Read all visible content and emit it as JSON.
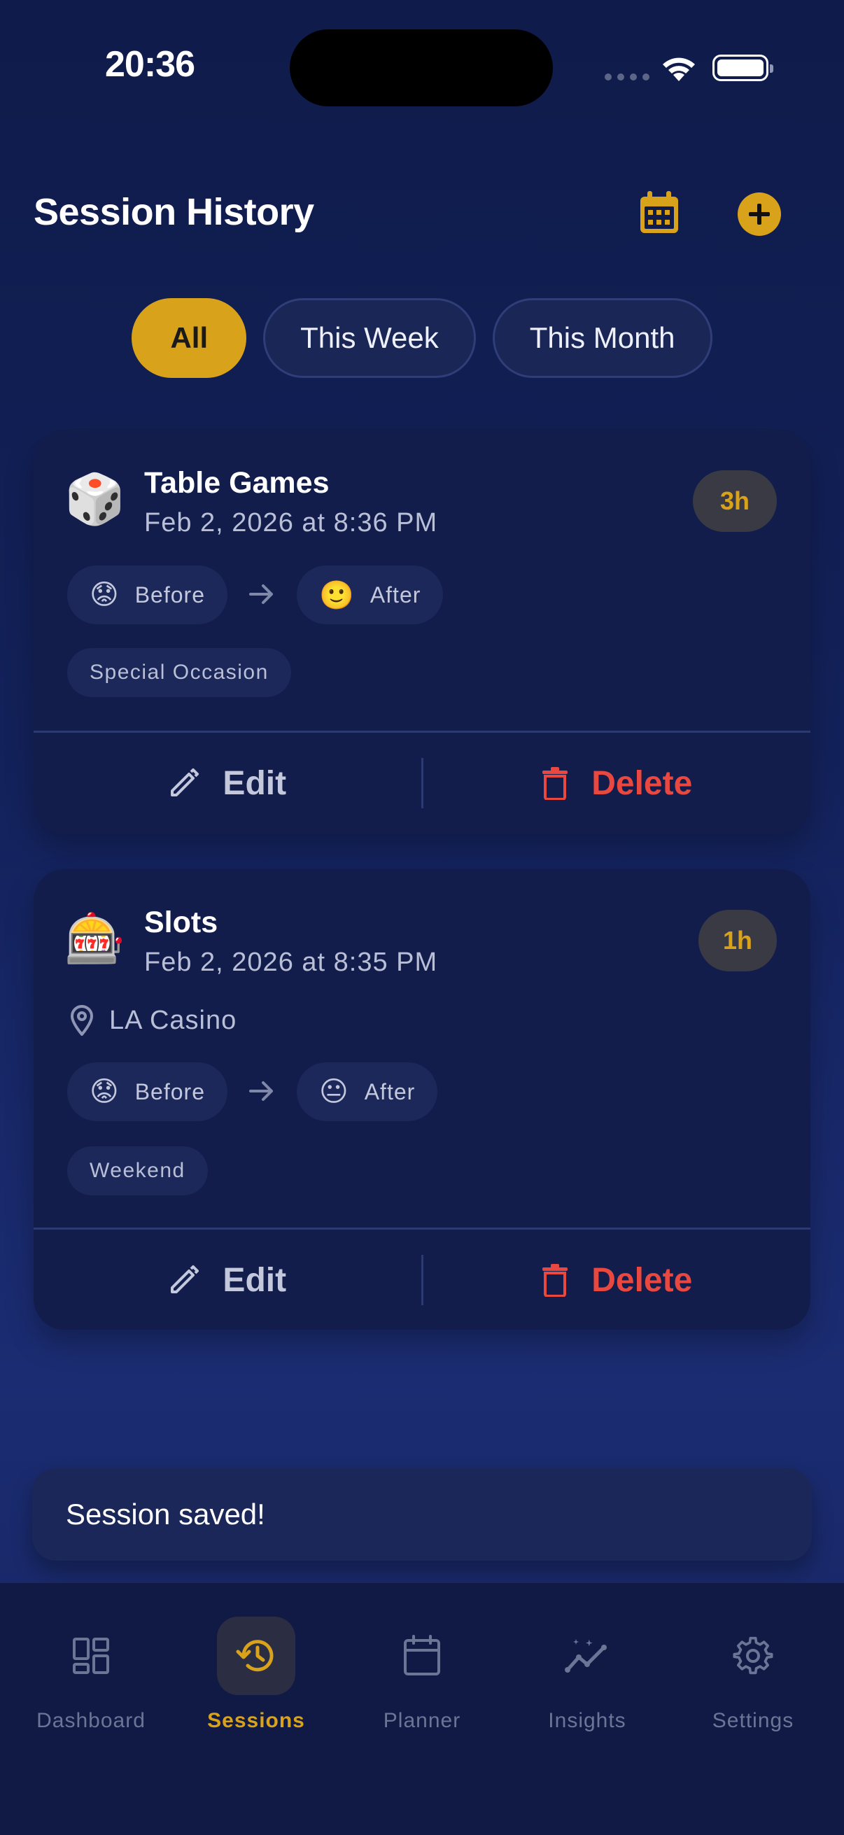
{
  "status_bar": {
    "time": "20:36"
  },
  "header": {
    "title": "Session History"
  },
  "filters": [
    {
      "label": "All",
      "active": true
    },
    {
      "label": "This Week",
      "active": false
    },
    {
      "label": "This Month",
      "active": false
    }
  ],
  "sessions": [
    {
      "emoji": "🎲",
      "title": "Table Games",
      "date": "Feb 2, 2026 at 8:36 PM",
      "duration": "3h",
      "before_emoji": "😟",
      "before_label": "Before",
      "after_emoji": "🙂",
      "after_label": "After",
      "tag": "Special Occasion",
      "edit_label": "Edit",
      "delete_label": "Delete"
    },
    {
      "emoji": "🎰",
      "title": "Slots",
      "date": "Feb 2, 2026 at 8:35 PM",
      "duration": "1h",
      "location": "LA Casino",
      "before_emoji": "😟",
      "before_label": "Before",
      "after_emoji": "😐",
      "after_label": "After",
      "tag": "Weekend",
      "edit_label": "Edit",
      "delete_label": "Delete"
    }
  ],
  "toast": {
    "message": "Session saved!"
  },
  "bottom_nav": [
    {
      "label": "Dashboard",
      "icon": "dashboard-icon",
      "active": false
    },
    {
      "label": "Sessions",
      "icon": "history-icon",
      "active": true
    },
    {
      "label": "Planner",
      "icon": "calendar-icon",
      "active": false
    },
    {
      "label": "Insights",
      "icon": "insights-icon",
      "active": false
    },
    {
      "label": "Settings",
      "icon": "gear-icon",
      "active": false
    }
  ],
  "colors": {
    "accent": "#d9a21b",
    "danger": "#e8483f",
    "background": "#13215a",
    "card": "#121d4c"
  }
}
